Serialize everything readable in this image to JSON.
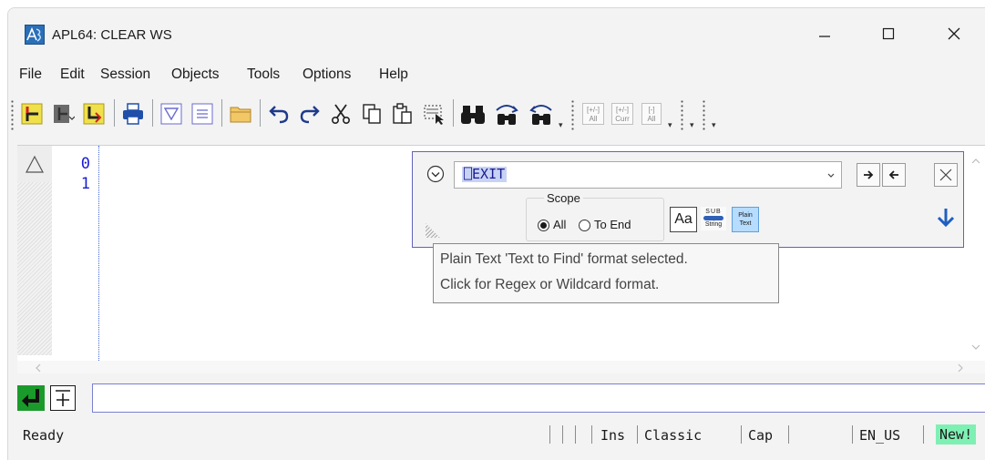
{
  "window": {
    "title": "APL64: CLEAR WS"
  },
  "menu": [
    "File",
    "Edit",
    "Session",
    "Objects",
    "Tools",
    "Options",
    "Help"
  ],
  "toolbar": {
    "paren_all": "[+/-]",
    "all_label": "All",
    "paren_curr": "[+/-]",
    "curr_label": "Curr",
    "collapse_all": "[-]",
    "collapse_all_label": "All"
  },
  "editor": {
    "line_numbers": [
      "0",
      "1"
    ]
  },
  "find": {
    "value": "⎕EXIT",
    "scope_label": "Scope",
    "scope_all": "All",
    "scope_to_end": "To End",
    "case_label": "Aa",
    "sub_top": "SUB",
    "sub_bottom": "String",
    "plain_top": "Plain",
    "plain_bottom": "Text"
  },
  "tooltip": {
    "line1": "Plain Text 'Text to Find' format selected.",
    "line2": "Click for Regex or Wildcard format."
  },
  "status": {
    "ready": "Ready",
    "ins": "Ins",
    "mode": "Classic",
    "cap": "Cap",
    "lang": "EN_US",
    "new": "New!"
  },
  "colors": {
    "accent": "#6264b8",
    "linenum": "#1a1ad6",
    "new_badge": "#7ff0b4"
  }
}
